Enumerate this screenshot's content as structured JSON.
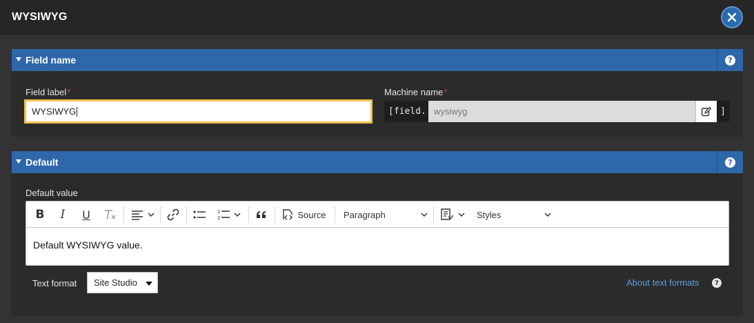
{
  "dialog": {
    "title": "WYSIWYG",
    "close_icon": "close-icon"
  },
  "field_name_panel": {
    "title": "Field name",
    "help_glyph": "?",
    "field_label": {
      "label": "Field label",
      "required_mark": "*",
      "value": "WYSIWYG"
    },
    "machine_name": {
      "label": "Machine name",
      "required_mark": "*",
      "prefix": "[field.",
      "value": "wysiwyg",
      "suffix": "]",
      "edit_icon": "edit-icon"
    }
  },
  "default_panel": {
    "title": "Default",
    "help_glyph": "?",
    "default_value_label": "Default value",
    "toolbar": {
      "bold_label": "B",
      "italic_label": "I",
      "underline_label": "U",
      "source_label": "Source",
      "heading_select": "Paragraph",
      "styles_select": "Styles"
    },
    "content": "Default WYSIWYG value.",
    "text_format": {
      "label": "Text format",
      "selected": "Site Studio",
      "about_link": "About text formats",
      "help_glyph": "?"
    }
  },
  "colors": {
    "panel_header": "#2e67aa",
    "focus_border": "#f0c24b",
    "link": "#5aa0e0",
    "required": "#e0453c"
  }
}
